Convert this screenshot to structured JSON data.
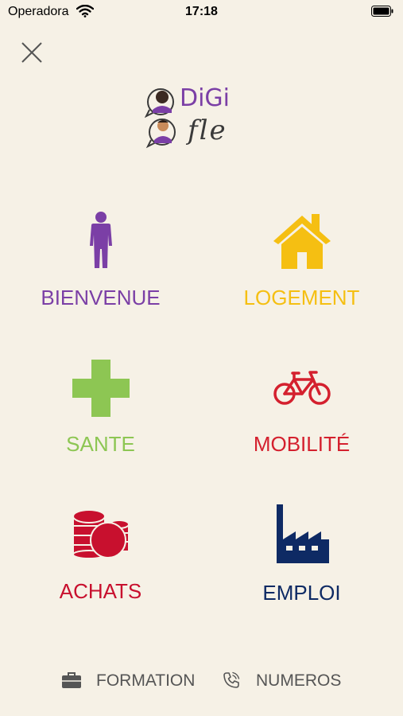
{
  "status_bar": {
    "carrier": "Operadora",
    "time": "17:18"
  },
  "logo": {
    "line1": "DiGi",
    "line2": "fle"
  },
  "tiles": [
    {
      "label": "BIENVENUE",
      "color": "#7b3fa6",
      "icon": "person-icon"
    },
    {
      "label": "LOGEMENT",
      "color": "#f5bf12",
      "icon": "house-icon"
    },
    {
      "label": "SANTE",
      "color": "#8dc653",
      "icon": "cross-icon"
    },
    {
      "label": "MOBILITÉ",
      "color": "#d4202e",
      "icon": "bicycle-icon"
    },
    {
      "label": "ACHATS",
      "color": "#c8102e",
      "icon": "coins-icon"
    },
    {
      "label": "EMPLOI",
      "color": "#0e2a64",
      "icon": "factory-icon"
    }
  ],
  "footer": {
    "formation": "FORMATION",
    "numeros": "NUMEROS"
  }
}
